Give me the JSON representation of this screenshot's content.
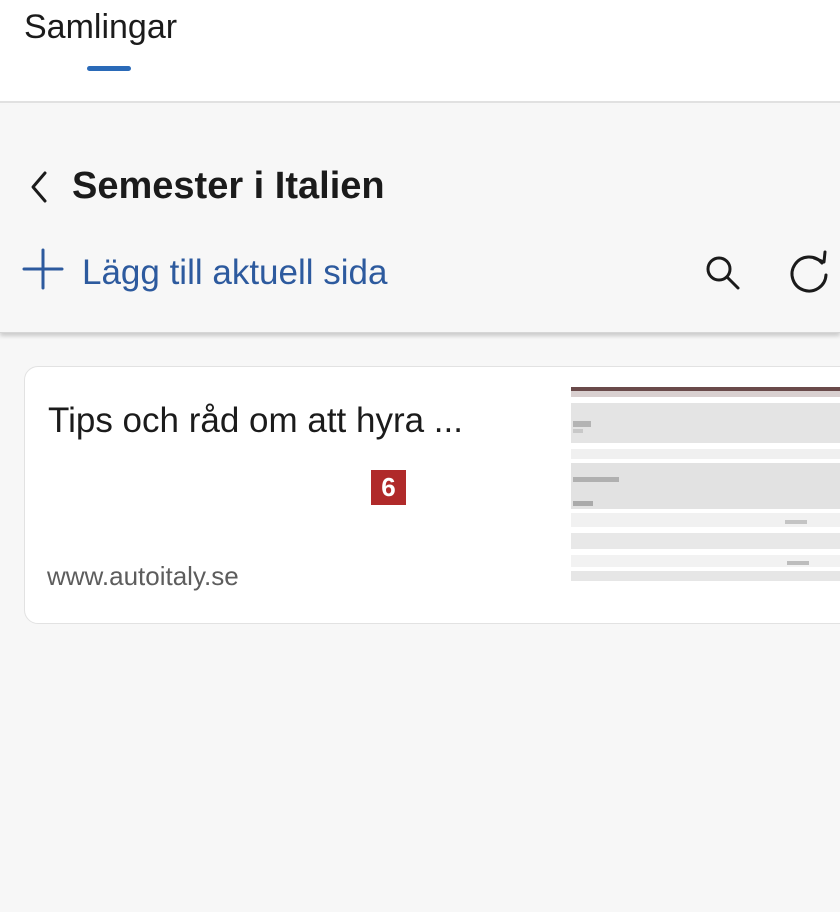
{
  "header": {
    "tab_label": "Samlingar",
    "accent_color": "#2a6ab8"
  },
  "collection": {
    "back_icon": "chevron-left-icon",
    "title": "Semester i Italien",
    "add_label": "Lägg till aktuell sida",
    "add_icon": "plus-icon",
    "search_icon": "search-icon",
    "refresh_icon": "refresh-icon",
    "link_color": "#2d5a9e"
  },
  "items": [
    {
      "title": "Tips och råd om att hyra ...",
      "url": "www.autoitaly.se",
      "badge": "6",
      "badge_color": "#b02a2a"
    }
  ]
}
